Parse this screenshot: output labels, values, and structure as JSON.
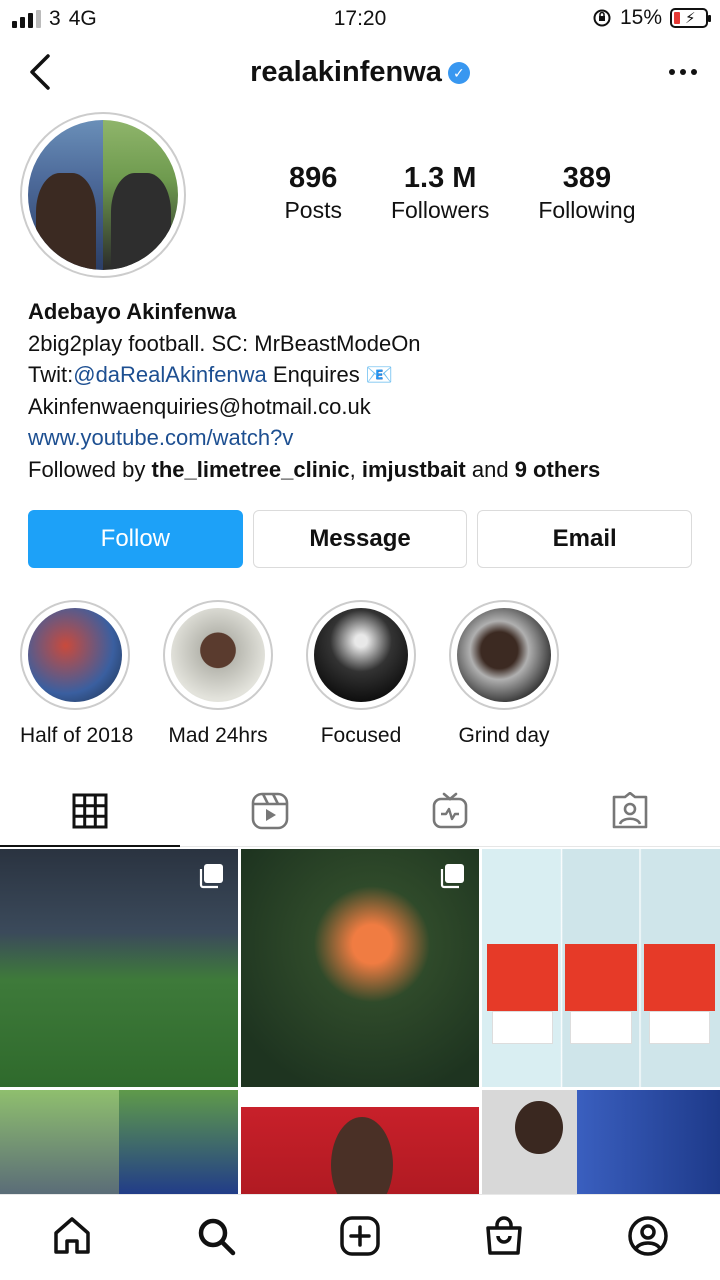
{
  "status_bar": {
    "carrier": "3",
    "network": "4G",
    "time": "17:20",
    "battery": "15%",
    "battery_level": 0.15
  },
  "header": {
    "username": "realakinfenwa",
    "verified": true
  },
  "profile": {
    "stats": [
      {
        "value": "896",
        "label": "Posts"
      },
      {
        "value": "1.3 M",
        "label": "Followers"
      },
      {
        "value": "389",
        "label": "Following"
      }
    ],
    "name": "Adebayo Akinfenwa",
    "bio_line1": "2big2play football. SC: MrBeastModeOn",
    "bio_line2_prefix": "Twit:",
    "bio_line2_handle": "@daRealAkinfenwa",
    "bio_line2_suffix": " Enquires 📧",
    "bio_line3": "Akinfenwaenquiries@hotmail.co.uk",
    "website": "www.youtube.com/watch?v",
    "followed_by_prefix": "Followed by ",
    "followed_by_user1": "the_limetree_clinic",
    "followed_by_sep": ", ",
    "followed_by_user2": "imjustbait",
    "followed_by_and": " and ",
    "followed_by_others": "9 others"
  },
  "actions": {
    "follow": "Follow",
    "message": "Message",
    "email": "Email"
  },
  "highlights": [
    {
      "label": "Half of 2018"
    },
    {
      "label": "Mad 24hrs"
    },
    {
      "label": "Focused"
    },
    {
      "label": "Grind day"
    }
  ],
  "tabs": [
    "grid-icon",
    "reels-icon",
    "igtv-icon",
    "tagged-icon"
  ],
  "grid_posts": [
    {
      "name": "post-1",
      "multi": true
    },
    {
      "name": "post-2",
      "multi": true
    },
    {
      "name": "post-3",
      "multi": false
    },
    {
      "name": "post-4",
      "multi": false
    },
    {
      "name": "post-5",
      "multi": false
    },
    {
      "name": "post-6",
      "multi": false
    }
  ],
  "bottom_nav": [
    "home-icon",
    "search-icon",
    "create-icon",
    "shop-icon",
    "profile-icon"
  ],
  "colors": {
    "accent": "#1da1f8",
    "verified": "#3897f0",
    "link": "#1d4f91",
    "battery_low": "#e53935"
  }
}
